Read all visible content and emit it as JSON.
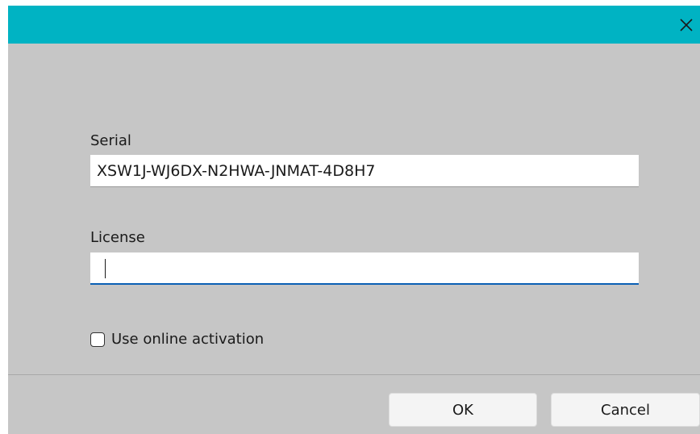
{
  "titlebar": {
    "close_symbol": "✕",
    "color": "#00b3c3"
  },
  "form": {
    "serial_label": "Serial",
    "serial_value": "XSW1J-WJ6DX-N2HWA-JNMAT-4D8H7",
    "license_label": "License",
    "license_value": "",
    "online_activation_label": "Use online activation",
    "online_activation_checked": false
  },
  "footer": {
    "ok_label": "OK",
    "cancel_label": "Cancel"
  },
  "icons": {
    "close": "close-icon",
    "checkbox": "checkbox-icon"
  },
  "colors": {
    "accent": "#00b3c3",
    "focus_underline": "#0a5fb4",
    "background": "#c6c6c6"
  }
}
